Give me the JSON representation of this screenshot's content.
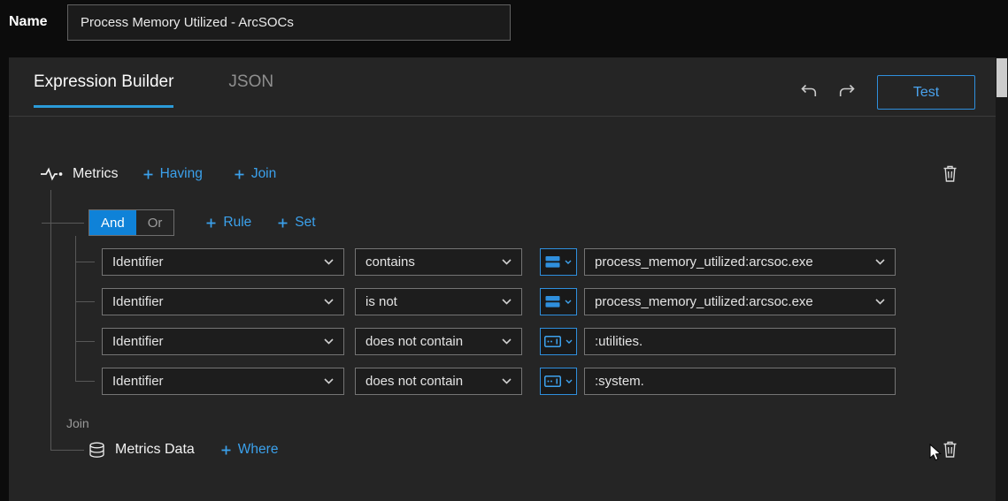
{
  "header": {
    "name_label": "Name",
    "name_value": "Process Memory Utilized - ArcSOCs"
  },
  "builder": {
    "tabs": [
      {
        "label": "Expression Builder",
        "active": true
      },
      {
        "label": "JSON",
        "active": false
      }
    ],
    "test_label": "Test",
    "metrics": {
      "label": "Metrics",
      "having_label": "Having",
      "join_label": "Join"
    },
    "group": {
      "and_label": "And",
      "or_label": "Or",
      "selected": "And",
      "rule_label": "Rule",
      "set_label": "Set"
    },
    "rules": [
      {
        "field": "Identifier",
        "operator": "contains",
        "value": "process_memory_utilized:arcsoc.exe",
        "value_control": "dropdown"
      },
      {
        "field": "Identifier",
        "operator": "is not",
        "value": "process_memory_utilized:arcsoc.exe",
        "value_control": "dropdown"
      },
      {
        "field": "Identifier",
        "operator": "does not contain",
        "value": ":utilities.",
        "value_control": "text"
      },
      {
        "field": "Identifier",
        "operator": "does not contain",
        "value": ":system.",
        "value_control": "text"
      }
    ],
    "join_section": {
      "label": "Join",
      "source_label": "Metrics Data",
      "where_label": "Where"
    }
  },
  "icons": {
    "metrics": "pulse-icon",
    "delete": "trash-icon",
    "history": [
      "undo-icon",
      "redo-icon"
    ],
    "rule_value_type_rows_1_2": "layers-icon",
    "rule_value_type_rows_3_4": "input-box-icon",
    "join_source": "database-icon",
    "dropdown": "chevron-down-icon",
    "add": "plus-icon",
    "pointer": "mouse-cursor"
  },
  "colors": {
    "accent": "#3ba1ec",
    "and_selected_bg": "#0f82d8",
    "page_bg": "#0c0c0c",
    "panel_bg": "#252525",
    "field_bg": "#1d1d1d",
    "field_border": "#757575",
    "tab_underline": "#2b9bd8"
  }
}
